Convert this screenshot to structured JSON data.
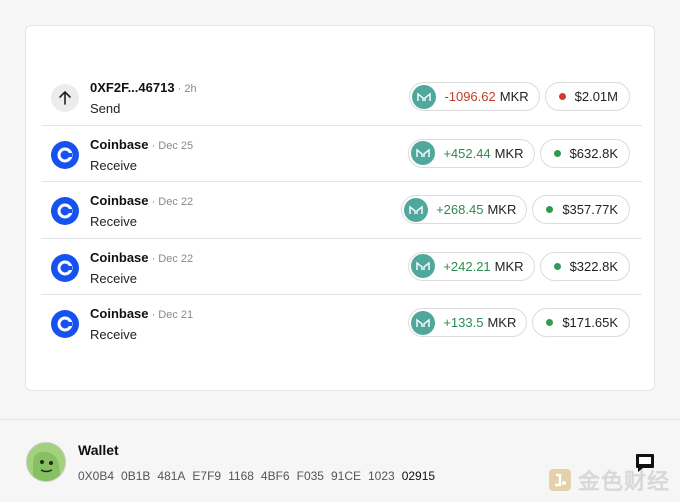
{
  "transactions": [
    {
      "title": "0XF2F...46713",
      "date": "2h",
      "type": "Send",
      "icon": "arrow-up-icon",
      "amount": "-1096.62",
      "direction": "neg",
      "unit": "MKR",
      "usd": "$2.01M",
      "dot": "red"
    },
    {
      "title": "Coinbase",
      "date": "Dec 25",
      "type": "Receive",
      "icon": "coinbase-icon",
      "amount": "+452.44",
      "direction": "pos",
      "unit": "MKR",
      "usd": "$632.8K",
      "dot": "green"
    },
    {
      "title": "Coinbase",
      "date": "Dec 22",
      "type": "Receive",
      "icon": "coinbase-icon",
      "amount": "+268.45",
      "direction": "pos",
      "unit": "MKR",
      "usd": "$357.77K",
      "dot": "green"
    },
    {
      "title": "Coinbase",
      "date": "Dec 22",
      "type": "Receive",
      "icon": "coinbase-icon",
      "amount": "+242.21",
      "direction": "pos",
      "unit": "MKR",
      "usd": "$322.8K",
      "dot": "green"
    },
    {
      "title": "Coinbase",
      "date": "Dec 21",
      "type": "Receive",
      "icon": "coinbase-icon",
      "amount": "+133.5",
      "direction": "pos",
      "unit": "MKR",
      "usd": "$171.65K",
      "dot": "green"
    }
  ],
  "wallet": {
    "title": "Wallet",
    "address": [
      "0X0B4",
      "0B1B",
      "481A",
      "E7F9",
      "1168",
      "4BF6",
      "F035",
      "91CE",
      "1023",
      "02915"
    ]
  },
  "watermark": {
    "text": "金色财经"
  },
  "colors": {
    "accent_green": "#2e8b4e",
    "accent_red": "#c43b2a",
    "coinbase_blue": "#1652f0",
    "mkr_teal": "#4fa89b"
  }
}
